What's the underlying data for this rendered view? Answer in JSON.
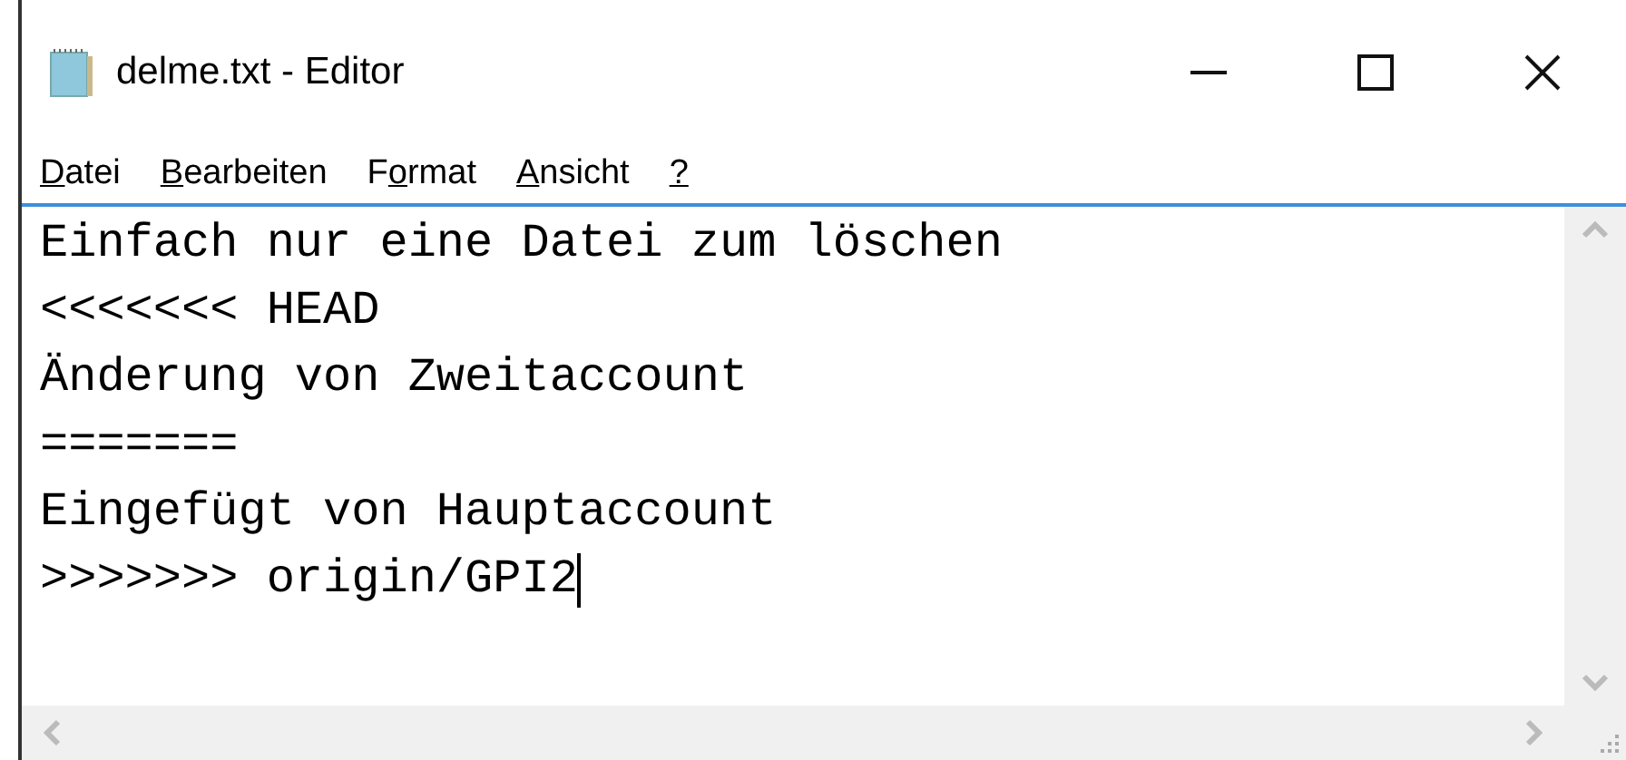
{
  "window": {
    "title": "delme.txt - Editor"
  },
  "menu": [
    {
      "key": "D",
      "after": "atei"
    },
    {
      "key": "B",
      "after": "earbeiten"
    },
    {
      "before": "F",
      "key": "o",
      "after": "rmat"
    },
    {
      "key": "A",
      "after": "nsicht"
    },
    {
      "key": "?"
    }
  ],
  "editor": {
    "lines": [
      "Einfach nur eine Datei zum löschen",
      "<<<<<<< HEAD",
      "Änderung von Zweitaccount",
      "=======",
      "Eingefügt von Hauptaccount",
      ">>>>>>> origin/GPI2"
    ]
  }
}
